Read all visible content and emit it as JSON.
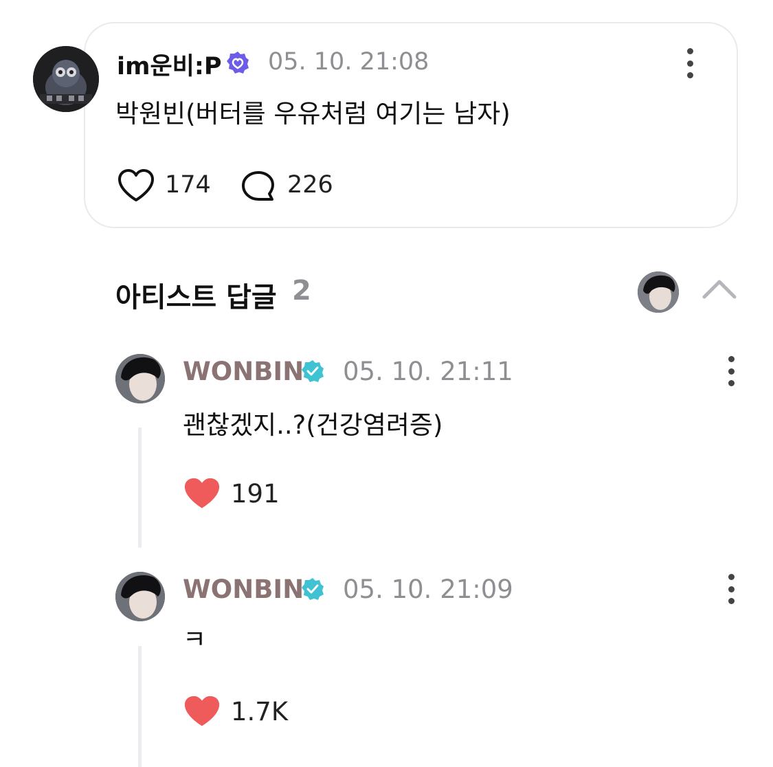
{
  "post": {
    "author": "im운비:P",
    "timestamp": "05. 10. 21:08",
    "text": "박원빈(버터를 우유처럼 여기는 남자)",
    "like_count": "174",
    "comment_count": "226",
    "icons": {
      "badge": "verified-badge-icon",
      "like": "heart-outline-icon",
      "comment": "speech-bubble-icon",
      "more": "more-vertical-icon"
    }
  },
  "artist_replies": {
    "title": "아티스트 답글",
    "count": "2",
    "icons": {
      "collapse": "chevron-up-icon"
    }
  },
  "replies": [
    {
      "author": "WONBIN",
      "timestamp": "05. 10. 21:11",
      "text": "괜찮겠지..?(건강염려증)",
      "like_count": "191"
    },
    {
      "author": "WONBIN",
      "timestamp": "05. 10. 21:09",
      "text": "ㅋ",
      "like_count": "1.7K"
    }
  ],
  "colors": {
    "artist_name": "#8a7372",
    "liked_heart": "#ef5a5a",
    "artist_badge": "#3fc2d2",
    "user_badge": "#6c5ce7",
    "muted_text": "#8e8e93"
  }
}
